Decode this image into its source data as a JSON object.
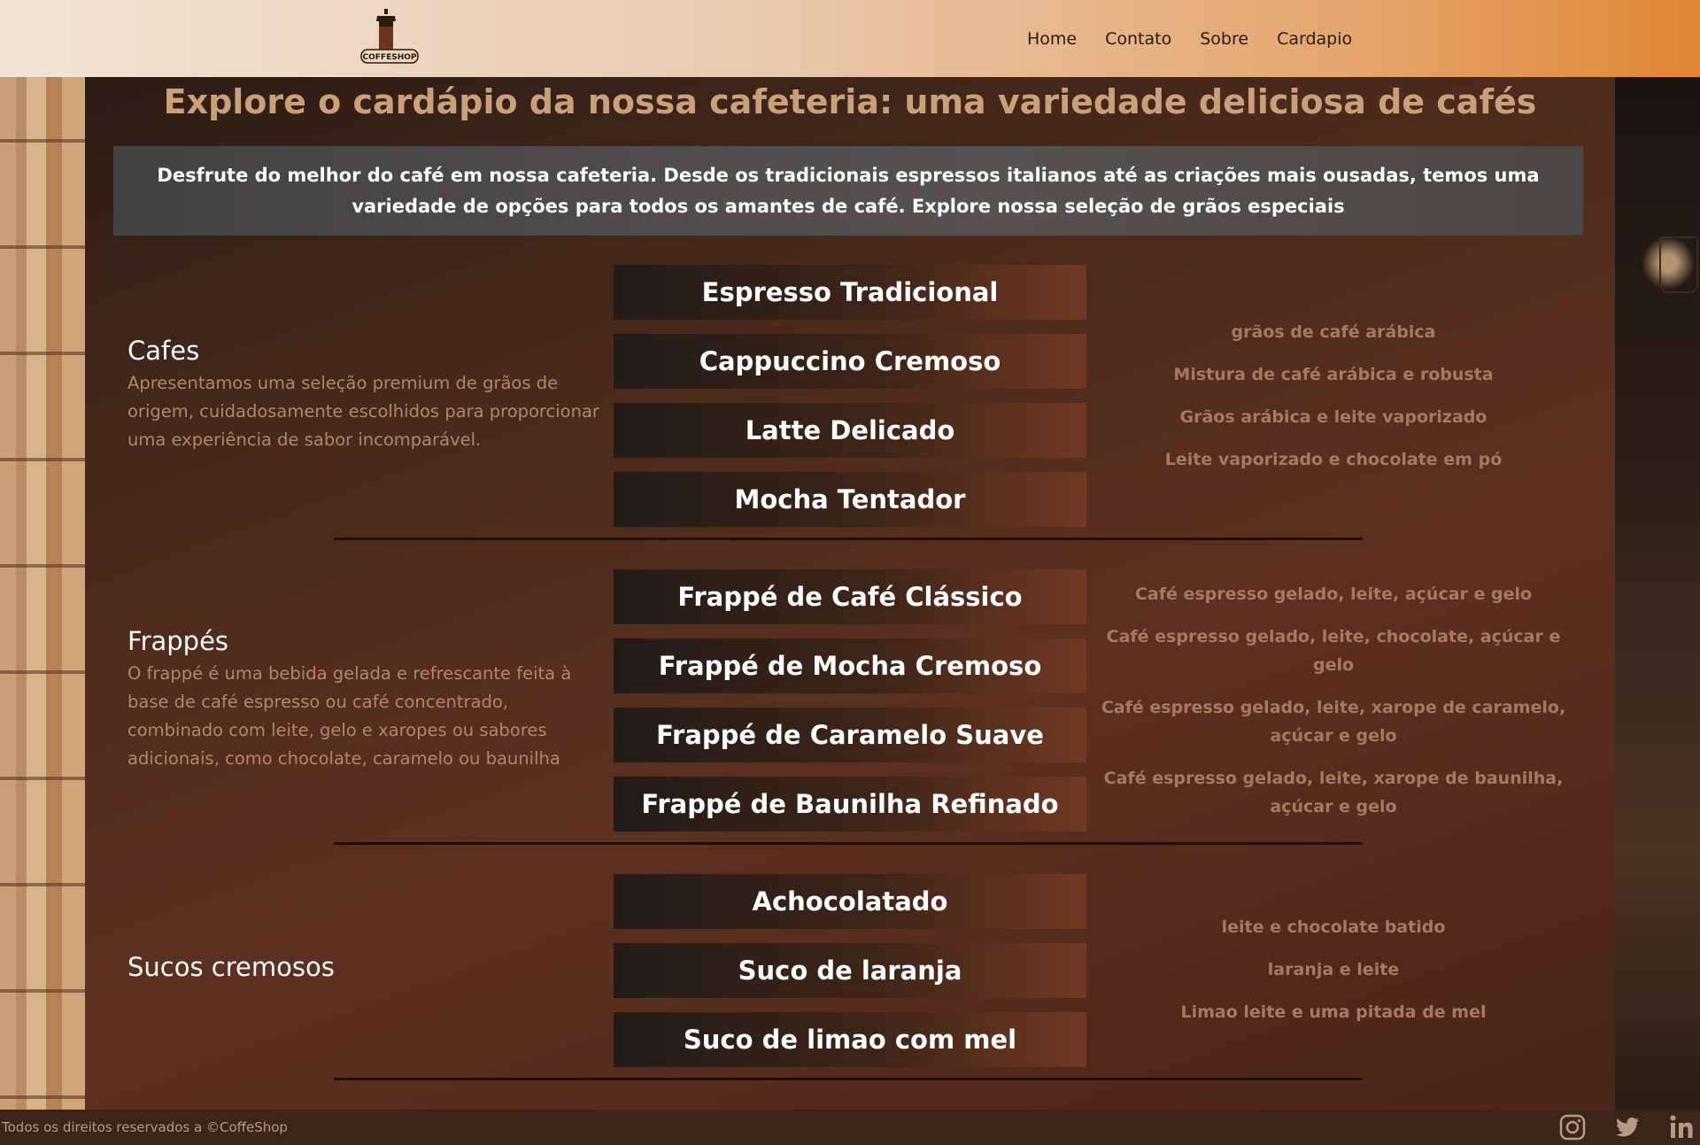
{
  "header": {
    "logo_text": "COFFESHOP",
    "nav": [
      {
        "label": "Home"
      },
      {
        "label": "Contato"
      },
      {
        "label": "Sobre"
      },
      {
        "label": "Cardapio"
      }
    ]
  },
  "page": {
    "title": "Explore o cardápio da nossa cafeteria: uma variedade deliciosa de cafés",
    "intro": "Desfrute do melhor do café em nossa cafeteria. Desde os tradicionais espressos italianos até as criações mais ousadas, temos uma variedade de opções para todos os amantes de café. Explore nossa seleção de grãos especiais"
  },
  "menu": [
    {
      "title": "Cafes",
      "description": "Apresentamos uma seleção premium de grãos de origem, cuidadosamente escolhidos para proporcionar uma experiência de sabor incomparável.",
      "items": [
        {
          "name": "Espresso Tradicional"
        },
        {
          "name": "Cappuccino Cremoso"
        },
        {
          "name": "Latte Delicado"
        },
        {
          "name": "Mocha Tentador"
        }
      ],
      "details": [
        "grãos de café arábica",
        "Mistura de café arábica e robusta",
        "Grãos arábica e leite vaporizado",
        "Leite vaporizado e chocolate em pó"
      ]
    },
    {
      "title": "Frappés",
      "description": "O frappé é uma bebida gelada e refrescante feita à base de café espresso ou café concentrado, combinado com leite, gelo e xaropes ou sabores adicionais, como chocolate, caramelo ou baunilha",
      "items": [
        {
          "name": "Frappé de Café Clássico"
        },
        {
          "name": "Frappé de Mocha Cremoso"
        },
        {
          "name": "Frappé de Caramelo Suave"
        },
        {
          "name": "Frappé de Baunilha Refinado"
        }
      ],
      "details": [
        "Café espresso gelado, leite, açúcar e gelo",
        "Café espresso gelado, leite, chocolate, açúcar e gelo",
        "Café espresso gelado, leite, xarope de caramelo, açúcar e gelo",
        "Café espresso gelado, leite, xarope de baunilha, açúcar e gelo"
      ]
    },
    {
      "title": "Sucos cremosos",
      "items": [
        {
          "name": "Achocolatado"
        },
        {
          "name": "Suco de laranja"
        },
        {
          "name": "Suco de limao com mel"
        }
      ],
      "details": [
        "leite e chocolate batido",
        "laranja e leite",
        "Limao leite e uma pitada de mel"
      ]
    }
  ],
  "footer": {
    "copyright": "Todos os direitos reservados a ©CoffeShop",
    "social": [
      {
        "icon": "instagram-icon"
      },
      {
        "icon": "twitter-icon"
      },
      {
        "icon": "linkedin-icon"
      }
    ]
  }
}
